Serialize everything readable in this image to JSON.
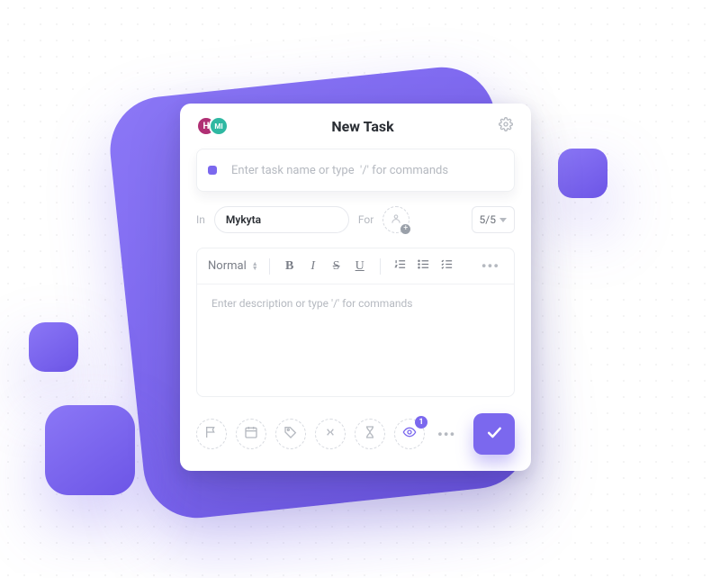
{
  "header": {
    "title": "New Task",
    "avatar1_initial": "H",
    "avatar2_initial": "MI"
  },
  "task": {
    "name_placeholder": "Enter task name or type  '/' for commands",
    "name_value": ""
  },
  "meta": {
    "in_label": "In",
    "in_value": "Mykyta",
    "for_label": "For",
    "count_label": "5/5"
  },
  "editor": {
    "style_label": "Normal",
    "bold_glyph": "B",
    "italic_glyph": "I",
    "strike_glyph": "S",
    "underline_glyph": "U",
    "desc_placeholder": "Enter description or type '/' for commands",
    "desc_value": ""
  },
  "footer": {
    "watch_count": "1"
  },
  "icons": {
    "flag": "flag-icon",
    "calendar": "calendar-icon",
    "tag": "tag-icon",
    "dependency": "dependency-icon",
    "hourglass": "hourglass-icon",
    "watch": "watch-icon",
    "more": "•••",
    "assign_plus": "+"
  },
  "colors": {
    "accent": "#7b68ee",
    "magenta": "#b02f74",
    "teal": "#2fb8a2"
  }
}
